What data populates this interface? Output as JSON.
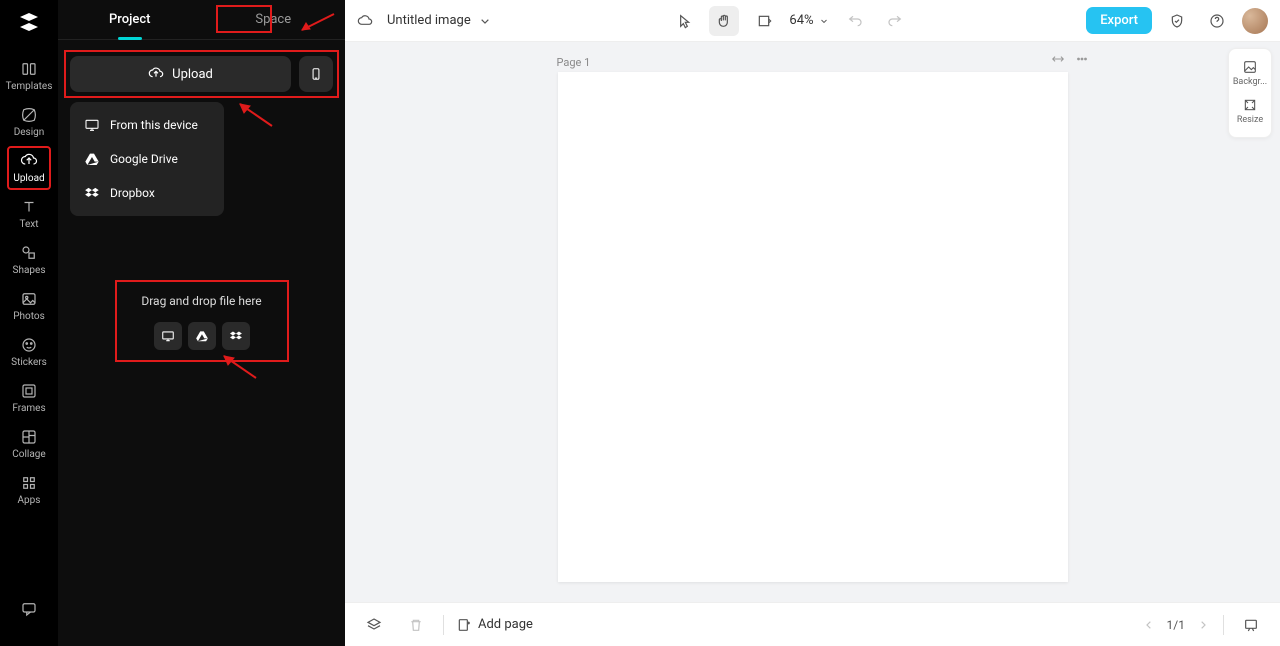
{
  "rail": {
    "items": [
      {
        "label": "Templates",
        "active": false
      },
      {
        "label": "Design",
        "active": false
      },
      {
        "label": "Upload",
        "active": true
      },
      {
        "label": "Text",
        "active": false
      },
      {
        "label": "Shapes",
        "active": false
      },
      {
        "label": "Photos",
        "active": false
      },
      {
        "label": "Stickers",
        "active": false
      },
      {
        "label": "Frames",
        "active": false
      },
      {
        "label": "Collage",
        "active": false
      },
      {
        "label": "Apps",
        "active": false
      }
    ]
  },
  "panel": {
    "tab_project": "Project",
    "tab_space": "Space",
    "upload_label": "Upload",
    "menu": {
      "from_device": "From this device",
      "google_drive": "Google Drive",
      "dropbox": "Dropbox"
    },
    "drop_text": "Drag and drop file here"
  },
  "topbar": {
    "title": "Untitled image",
    "zoom": "64%",
    "export": "Export"
  },
  "canvas": {
    "page_label": "Page 1"
  },
  "right_tools": {
    "background": "Backgr...",
    "resize": "Resize"
  },
  "bottombar": {
    "add_page": "Add page",
    "page_indicator": "1/1"
  }
}
